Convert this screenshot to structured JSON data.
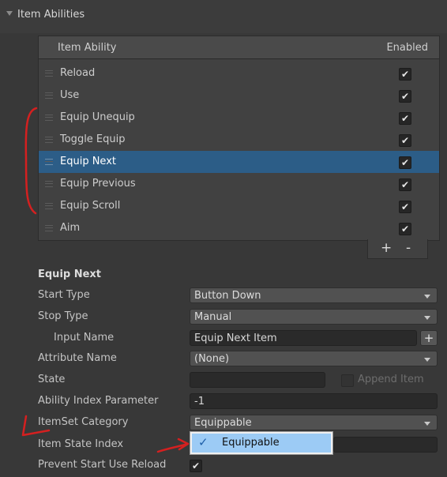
{
  "section": {
    "title": "Item Abilities"
  },
  "list": {
    "col_ability": "Item Ability",
    "col_enabled": "Enabled",
    "rows": [
      {
        "label": "Reload",
        "enabled": true,
        "selected": false
      },
      {
        "label": "Use",
        "enabled": true,
        "selected": false
      },
      {
        "label": "Equip Unequip",
        "enabled": true,
        "selected": false
      },
      {
        "label": "Toggle Equip",
        "enabled": true,
        "selected": false
      },
      {
        "label": "Equip Next",
        "enabled": true,
        "selected": true
      },
      {
        "label": "Equip Previous",
        "enabled": true,
        "selected": false
      },
      {
        "label": "Equip Scroll",
        "enabled": true,
        "selected": false
      },
      {
        "label": "Aim",
        "enabled": true,
        "selected": false
      }
    ],
    "add_label": "+",
    "remove_label": "-"
  },
  "props": {
    "title": "Equip Next",
    "start_type_label": "Start Type",
    "start_type_value": "Button Down",
    "stop_type_label": "Stop Type",
    "stop_type_value": "Manual",
    "input_name_label": "Input Name",
    "input_name_value": "Equip Next Item",
    "attribute_name_label": "Attribute Name",
    "attribute_name_value": "(None)",
    "state_label": "State",
    "state_value": "",
    "append_item_label": "Append Item",
    "ability_index_label": "Ability Index Parameter",
    "ability_index_value": "-1",
    "itemset_category_label": "ItemSet Category",
    "itemset_category_value": "Equippable",
    "item_state_index_label": "Item State Index",
    "prevent_start_label": "Prevent Start Use Reload",
    "prevent_start_checked": true
  },
  "popup": {
    "option": "Equippable",
    "selected": true
  },
  "glyphs": {
    "check": "✔",
    "plus": "+",
    "tick": "✓"
  },
  "colors": {
    "selection": "#2c5d87",
    "annotation": "#d42020",
    "popup_highlight": "#9ccbf5"
  }
}
